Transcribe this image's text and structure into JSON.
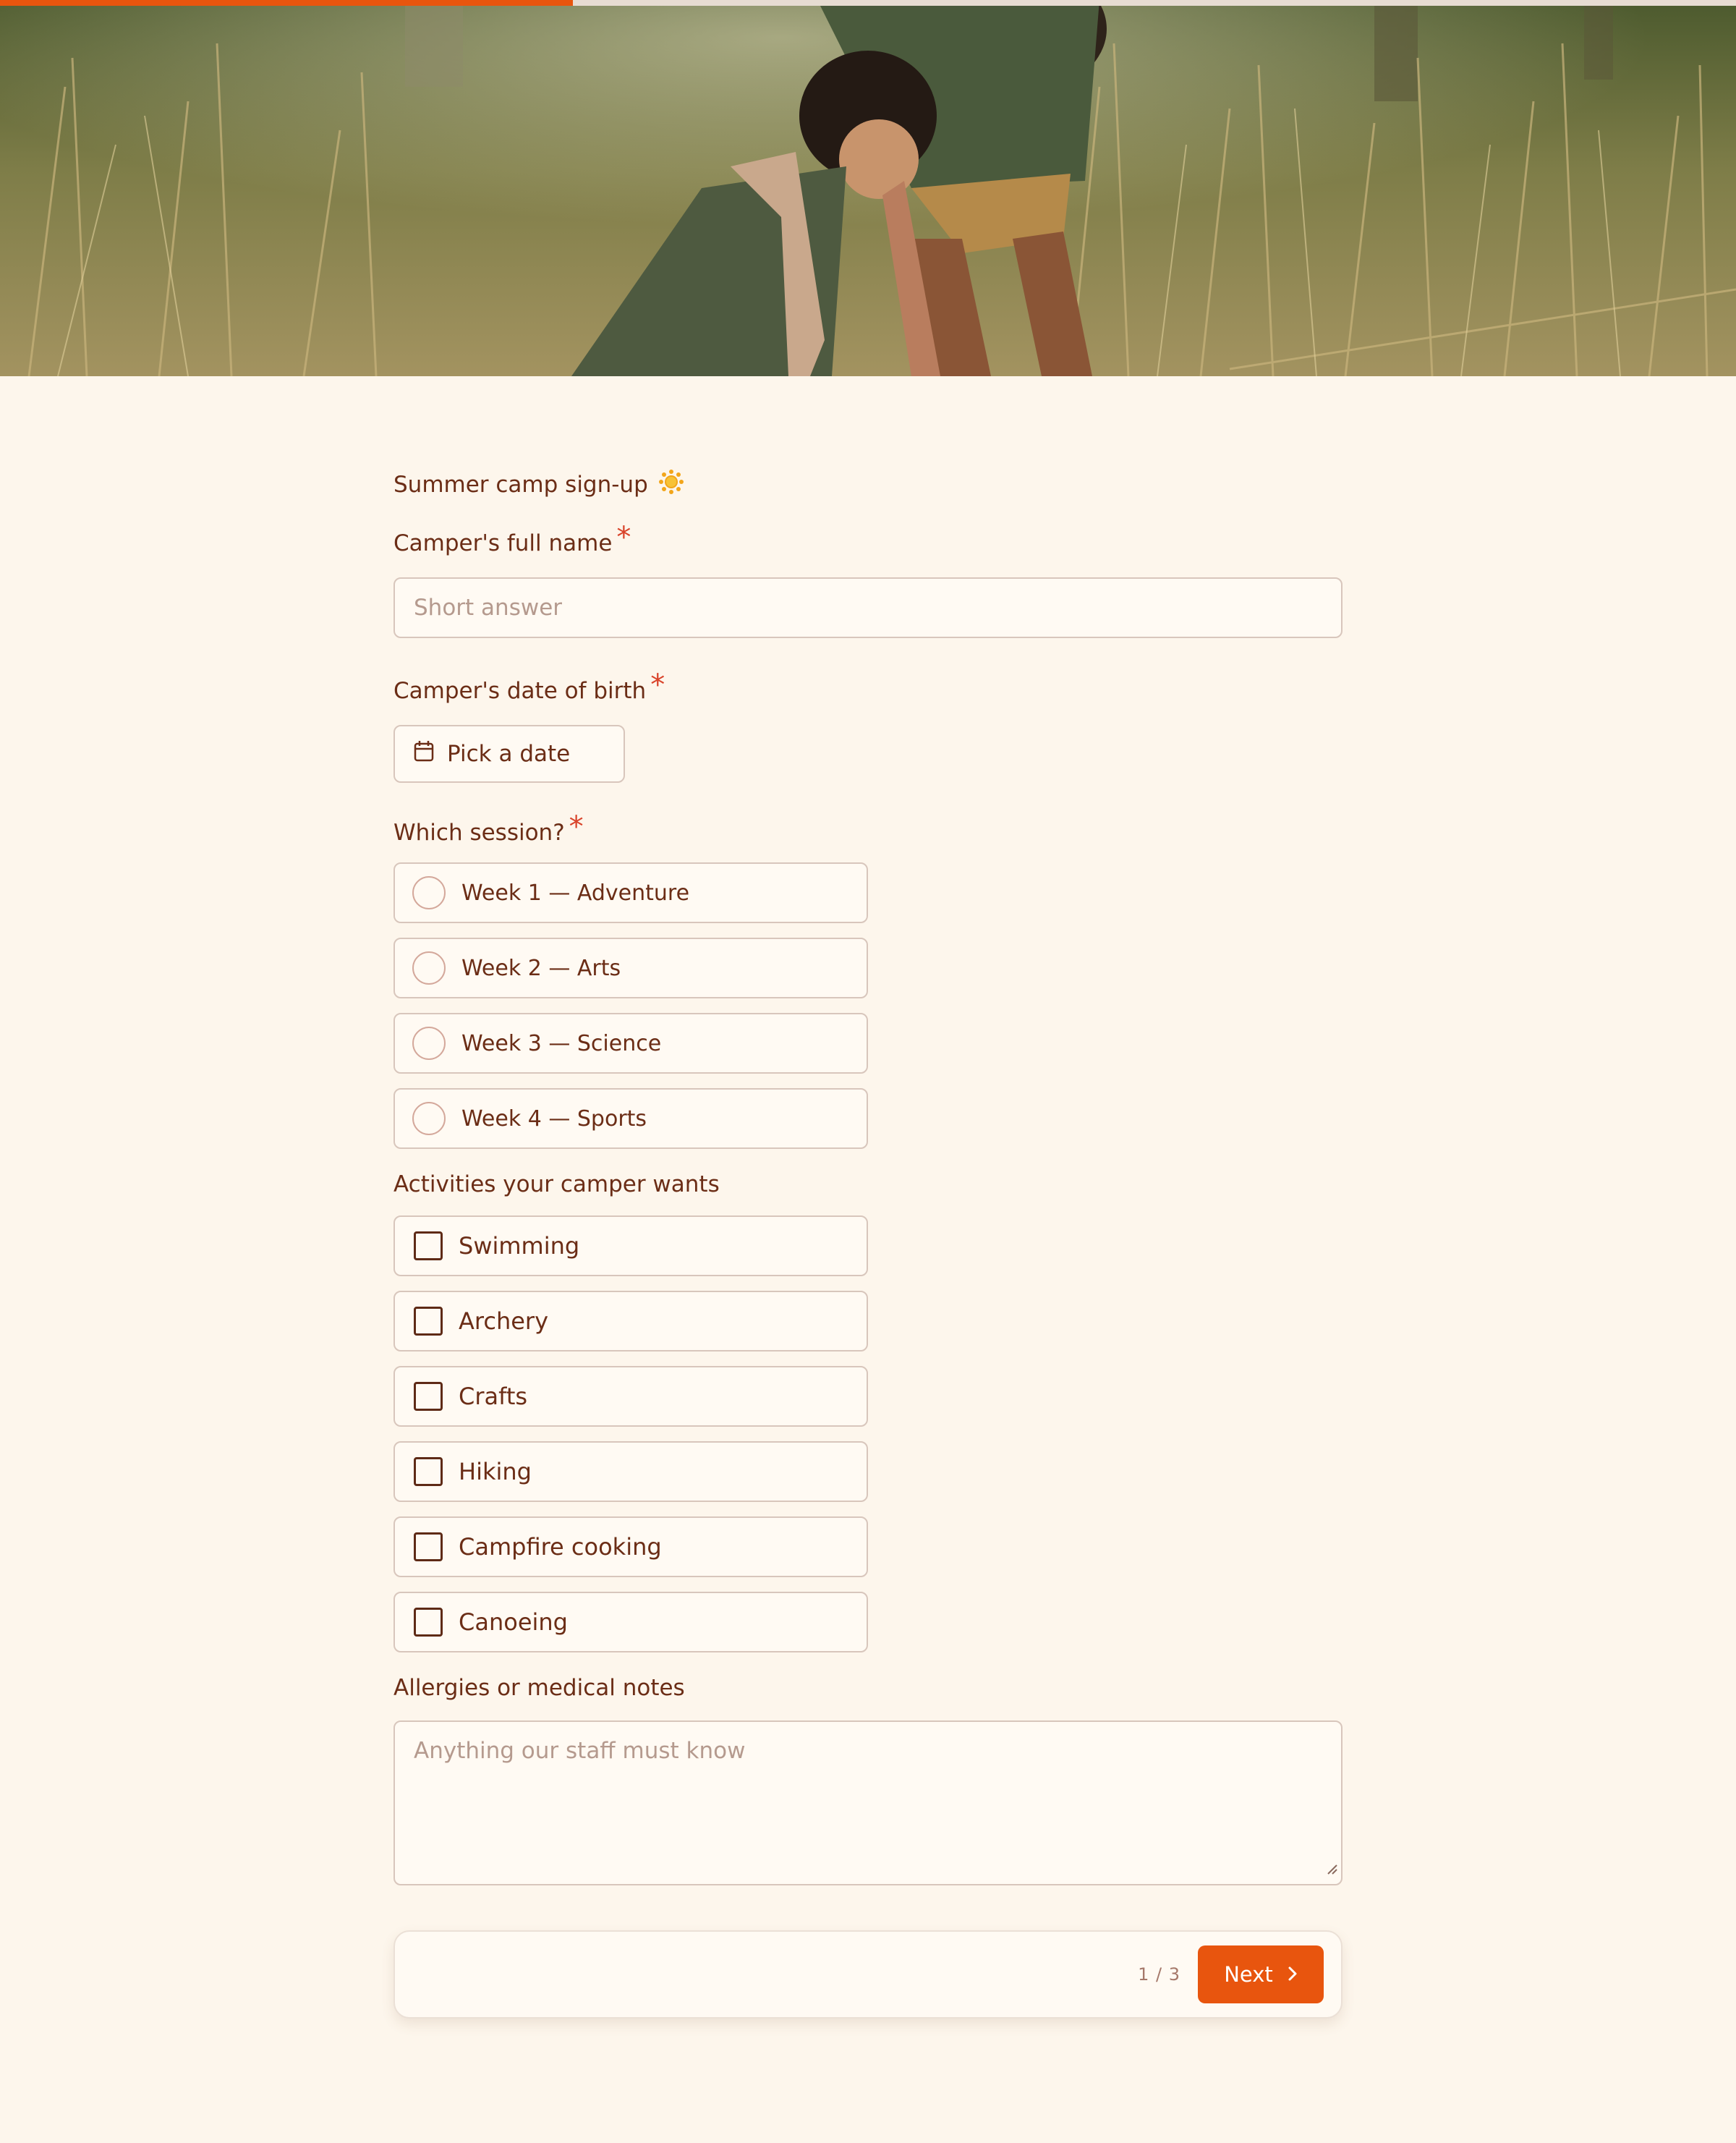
{
  "progress": {
    "fraction": 0.33,
    "color": "#e8550e"
  },
  "hero": {
    "image_description_icon": "camp-photo-image"
  },
  "form": {
    "title": "Summer camp sign-up",
    "title_icon": "sun-icon",
    "required_marker": "*",
    "full_name": {
      "label": "Camper's full name",
      "placeholder": "Short answer"
    },
    "dob": {
      "label": "Camper's date of birth",
      "button_label": "Pick a date",
      "icon": "calendar-icon"
    },
    "session": {
      "label": "Which session?",
      "options": [
        "Week 1 — Adventure",
        "Week 2 — Arts",
        "Week 3 — Science",
        "Week 4 — Sports"
      ]
    },
    "activities": {
      "label": "Activities your camper wants",
      "options": [
        "Swimming",
        "Archery",
        "Crafts",
        "Hiking",
        "Campfire cooking",
        "Canoeing"
      ]
    },
    "notes": {
      "label": "Allergies or medical notes",
      "placeholder": "Anything our staff must know"
    }
  },
  "footer": {
    "page_indicator": "1 / 3",
    "next_label": "Next",
    "next_icon": "chevron-right-icon"
  },
  "colors": {
    "accent": "#e8550e",
    "text": "#6b2d16",
    "background": "#fdf6ec",
    "required": "#d9432a"
  }
}
